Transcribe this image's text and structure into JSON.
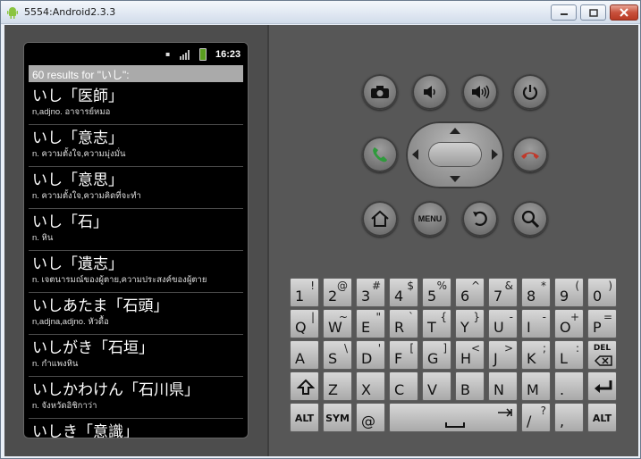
{
  "window": {
    "title": "5554:Android2.3.3"
  },
  "status_bar": {
    "time": "16:23"
  },
  "results_header": "60 results for \"いし\":",
  "entries": [
    {
      "word": "いし「医師」",
      "definition": "n,adjno. อาจารย์หมอ"
    },
    {
      "word": "いし「意志」",
      "definition": "n. ความตั้งใจ,ความมุ่งมั่น"
    },
    {
      "word": "いし「意思」",
      "definition": "n. ความตั้งใจ,ความคิดที่จะทำ"
    },
    {
      "word": "いし「石」",
      "definition": "n. หิน"
    },
    {
      "word": "いし「遺志」",
      "definition": "n. เจตนารมณ์ของผู้ตาย,ความประสงค์ของผู้ตาย"
    },
    {
      "word": "いしあたま「石頭」",
      "definition": "n,adjna,adjno. หัวดื้อ"
    },
    {
      "word": "いしがき「石垣」",
      "definition": "n. กำแพงหิน"
    },
    {
      "word": "いしかわけん「石川県」",
      "definition": "n. จังหวัดอิชิกาว่า"
    },
    {
      "word": "いしき「意識」",
      "definition": ""
    }
  ],
  "hardware_buttons": {
    "menu_label": "MENU"
  },
  "keyboard": {
    "rows": [
      [
        {
          "k": "1",
          "a": "!"
        },
        {
          "k": "2",
          "a": "@"
        },
        {
          "k": "3",
          "a": "#"
        },
        {
          "k": "4",
          "a": "$"
        },
        {
          "k": "5",
          "a": "%"
        },
        {
          "k": "6",
          "a": "^"
        },
        {
          "k": "7",
          "a": "&"
        },
        {
          "k": "8",
          "a": "*"
        },
        {
          "k": "9",
          "a": "("
        },
        {
          "k": "0",
          "a": ")"
        }
      ],
      [
        {
          "k": "Q",
          "a": "|"
        },
        {
          "k": "W",
          "a": "~"
        },
        {
          "k": "E",
          "a": "\""
        },
        {
          "k": "R",
          "a": "`"
        },
        {
          "k": "T",
          "a": "{"
        },
        {
          "k": "Y",
          "a": "}"
        },
        {
          "k": "U",
          "a": "-"
        },
        {
          "k": "I",
          "a": "-"
        },
        {
          "k": "O",
          "a": "+"
        },
        {
          "k": "P",
          "a": "="
        }
      ],
      [
        {
          "k": "A",
          "a": ""
        },
        {
          "k": "S",
          "a": "\\"
        },
        {
          "k": "D",
          "a": "'"
        },
        {
          "k": "F",
          "a": "["
        },
        {
          "k": "G",
          "a": "]"
        },
        {
          "k": "H",
          "a": "<"
        },
        {
          "k": "J",
          "a": ">"
        },
        {
          "k": "K",
          "a": ";"
        },
        {
          "k": "L",
          "a": ":"
        },
        {
          "k": "DEL",
          "a": ""
        }
      ],
      [
        {
          "k": "SHIFT",
          "a": ""
        },
        {
          "k": "Z",
          "a": ""
        },
        {
          "k": "X",
          "a": ""
        },
        {
          "k": "C",
          "a": ""
        },
        {
          "k": "V",
          "a": ""
        },
        {
          "k": "B",
          "a": ""
        },
        {
          "k": "N",
          "a": ""
        },
        {
          "k": "M",
          "a": ""
        },
        {
          "k": ".",
          "a": ""
        },
        {
          "k": "ENTER",
          "a": ""
        }
      ]
    ],
    "bottom": {
      "alt": "ALT",
      "sym": "SYM",
      "at": "@",
      "slash": "/",
      "question": "?",
      "comma": ",",
      "alt_right": "ALT"
    }
  },
  "colors": {
    "status_green": "#5a9e1f",
    "call_green": "#2f9a3c",
    "end_red": "#c0392b"
  }
}
